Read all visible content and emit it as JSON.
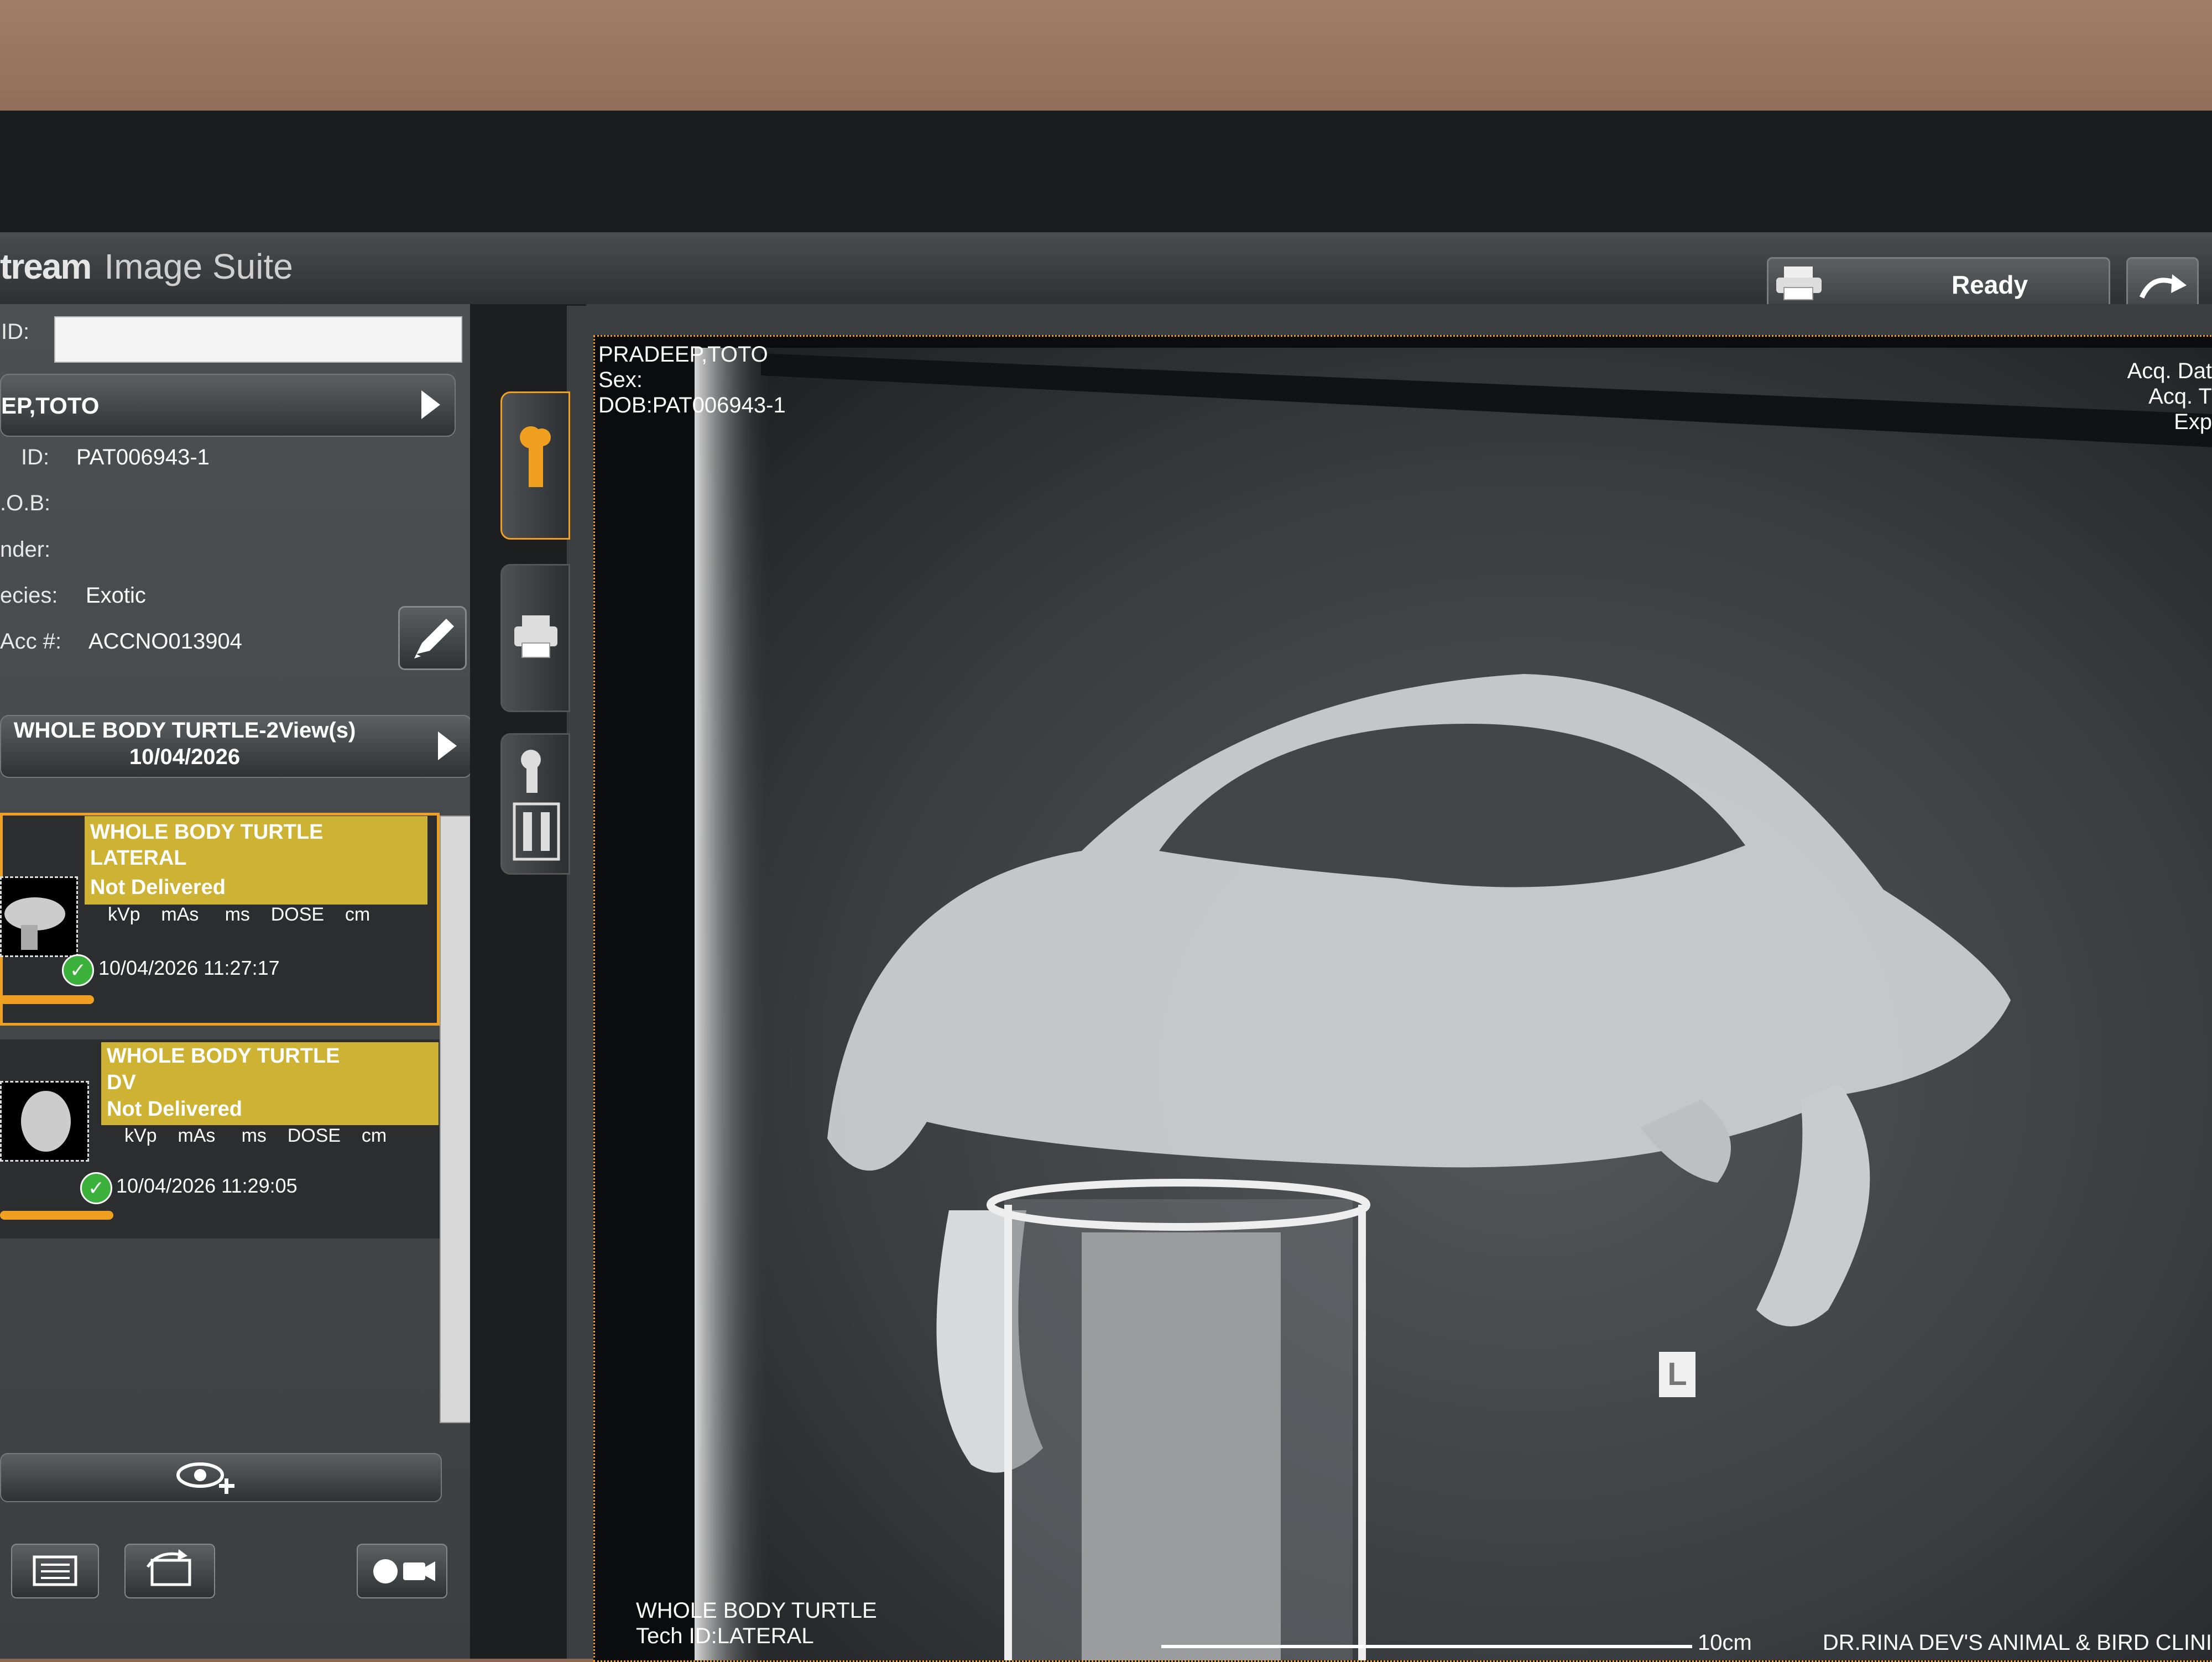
{
  "app": {
    "brand": "tream",
    "suite": "Image Suite",
    "status": "Ready"
  },
  "patient": {
    "id_label": "ID:",
    "id_value": "",
    "name": "EP,TOTO",
    "fields": [
      {
        "label": "ID:",
        "value": "PAT006943-1"
      },
      {
        "label": ".O.B:",
        "value": ""
      },
      {
        "label": "nder:",
        "value": ""
      },
      {
        "label": "ecies:",
        "value": "Exotic"
      },
      {
        "label": "Acc #:",
        "value": "ACCNO013904"
      }
    ]
  },
  "study": {
    "title": "WHOLE BODY TURTLE-2View(s)",
    "date": "10/04/2026"
  },
  "series": [
    {
      "title": "WHOLE BODY TURTLE",
      "view": "LATERAL",
      "status": "Not Delivered",
      "params": "kVp    mAs     ms    DOSE    cm",
      "timestamp": "10/04/2026 11:27:17",
      "selected": true
    },
    {
      "title": "WHOLE BODY TURTLE",
      "view": "DV",
      "status": "Not Delivered",
      "params": "kVp    mAs     ms    DOSE    cm",
      "timestamp": "10/04/2026 11:29:05",
      "selected": false
    }
  ],
  "viewer": {
    "overlay_top_left": [
      "PRADEEP,TOTO",
      "Sex:",
      "DOB:PAT006943-1"
    ],
    "overlay_top_right": [
      "Acq. Dat",
      "Acq. T",
      "Exp"
    ],
    "overlay_bottom_left": [
      "WHOLE BODY TURTLE",
      "Tech ID:LATERAL"
    ],
    "overlay_bottom_right": "DR.RINA DEV'S ANIMAL & BIRD CLINI",
    "scale_label": "10cm",
    "marker": "L"
  },
  "icons": [
    "printer-icon",
    "redo-icon",
    "edit-icon",
    "bone-icon",
    "print-icon",
    "compare-bone-icon",
    "eye-add-icon",
    "list-icon",
    "screen-rotate-icon",
    "video-camera-icon",
    "chevron-right-icon",
    "check-icon"
  ],
  "colors": {
    "accent": "#f0a020",
    "series_header": "#cdb234",
    "ready_bg": "#4a4d50"
  }
}
